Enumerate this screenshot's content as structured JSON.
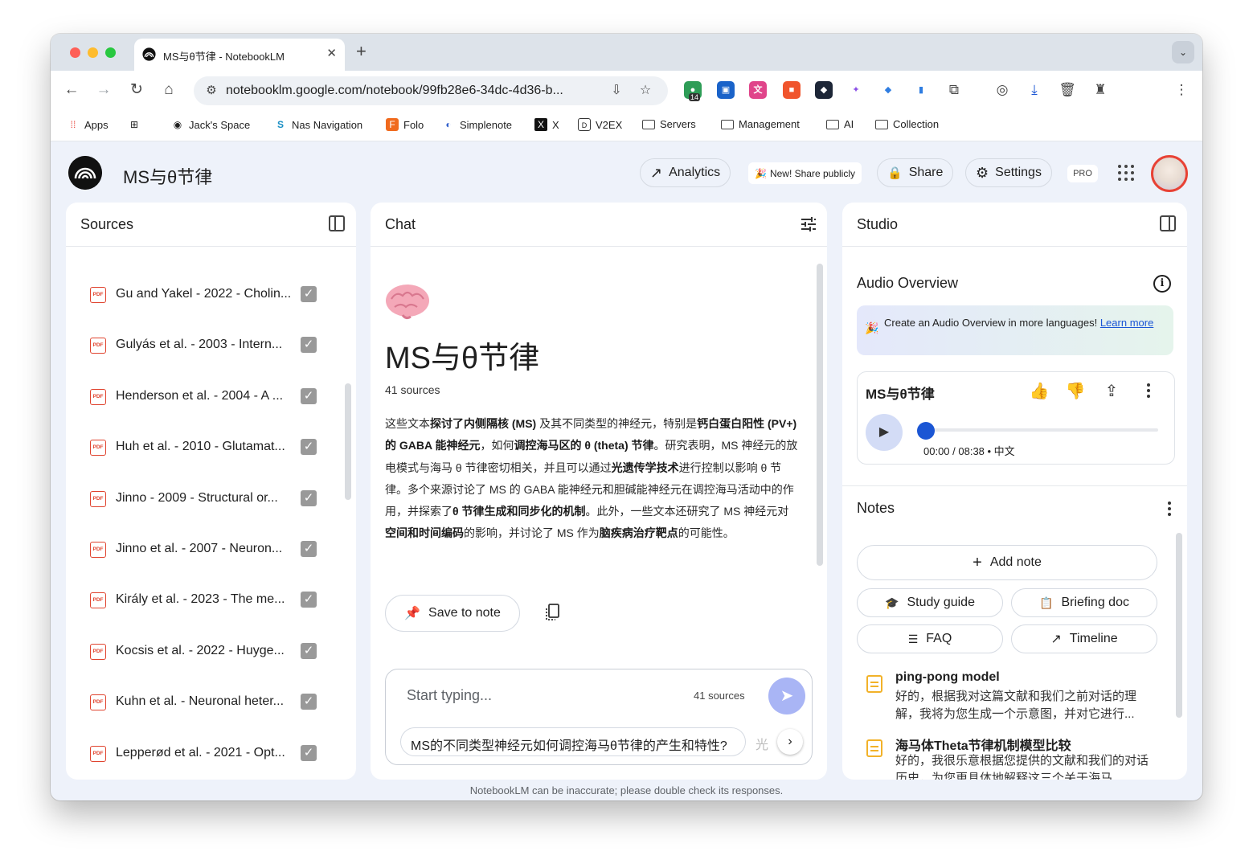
{
  "browser": {
    "tab_title": "MS与θ节律 - NotebookLM",
    "url": "notebooklm.google.com/notebook/99fb28e6-34dc-4d36-b...",
    "extension_badge": "14",
    "bookmarks": [
      {
        "label": "Apps",
        "icon": "apps-grid-icon"
      },
      {
        "label": "Jack's Space",
        "icon": "circle-logo-icon"
      },
      {
        "label": "Nas Navigation",
        "icon": "s-logo-icon"
      },
      {
        "label": "Folo",
        "icon": "folo-icon"
      },
      {
        "label": "Simplenote",
        "icon": "simplenote-icon"
      },
      {
        "label": "X",
        "icon": "x-logo-icon"
      },
      {
        "label": "V2EX",
        "icon": "v2ex-icon"
      },
      {
        "label": "Servers",
        "icon": "folder-icon"
      },
      {
        "label": "Management",
        "icon": "folder-icon"
      },
      {
        "label": "AI",
        "icon": "folder-icon"
      },
      {
        "label": "Collection",
        "icon": "folder-icon"
      }
    ]
  },
  "header": {
    "title": "MS与θ节律",
    "analytics_label": "Analytics",
    "share_public_label": "New! Share publicly",
    "share_label": "Share",
    "settings_label": "Settings",
    "pro_label": "PRO"
  },
  "sources": {
    "title": "Sources",
    "items": [
      {
        "label": "Gu and Yakel - 2022 - Cholin...",
        "checked": true
      },
      {
        "label": "Gulyás et al. - 2003 - Intern...",
        "checked": true
      },
      {
        "label": "Henderson et al. - 2004 - A ...",
        "checked": true
      },
      {
        "label": "Huh et al. - 2010 - Glutamat...",
        "checked": true
      },
      {
        "label": "Jinno - 2009 - Structural or...",
        "checked": true
      },
      {
        "label": "Jinno et al. - 2007 - Neuron...",
        "checked": true
      },
      {
        "label": "Király et al. - 2023 - The me...",
        "checked": true
      },
      {
        "label": "Kocsis et al. - 2022 - Huyge...",
        "checked": true
      },
      {
        "label": "Kuhn et al. - Neuronal heter...",
        "checked": true
      },
      {
        "label": "Lepperød et al. - 2021 - Opt...",
        "checked": true
      }
    ],
    "pdf_label": "PDF"
  },
  "chat": {
    "title": "Chat",
    "notebook_title": "MS与θ节律",
    "source_count": "41 sources",
    "summary": [
      {
        "t": "这些文本",
        "b": false
      },
      {
        "t": "探讨了内侧隔核 (MS)",
        "b": true
      },
      {
        "t": " 及其不同类型的神经元，特别是",
        "b": false
      },
      {
        "t": "钙白蛋白阳性 (PV+) 的 GABA 能神经元",
        "b": true
      },
      {
        "t": "，如何",
        "b": false
      },
      {
        "t": "调控海马区的 θ (theta) 节律",
        "b": true
      },
      {
        "t": "。研究表明，MS 神经元的放电模式与海马 θ 节律密切相关，并且可以通过",
        "b": false
      },
      {
        "t": "光遗传学技术",
        "b": true
      },
      {
        "t": "进行控制以影响 θ 节律。多个来源讨论了 MS 的 GABA 能神经元和胆碱能神经元在调控海马活动中的作用，并探索了",
        "b": false
      },
      {
        "t": "θ 节律生成和同步化的机制",
        "b": true
      },
      {
        "t": "。此外，一些文本还研究了 MS 神经元对",
        "b": false
      },
      {
        "t": "空间和时间编码",
        "b": true
      },
      {
        "t": "的影响，并讨论了 MS 作为",
        "b": false
      },
      {
        "t": "脑疾病治疗靶点",
        "b": true
      },
      {
        "t": "的可能性。",
        "b": false
      }
    ],
    "save_to_note_label": "Save to note",
    "input_placeholder": "Start typing...",
    "input_source_count": "41 sources",
    "suggestion": "MS的不同类型神经元如何调控海马θ节律的产生和特性?",
    "suggestion_next": "光",
    "disclaimer": "NotebookLM can be inaccurate; please double check its responses."
  },
  "studio": {
    "title": "Studio",
    "audio_overview_title": "Audio Overview",
    "promo_text": "Create an Audio Overview in more languages! ",
    "promo_link": "Learn more",
    "audio_title": "MS与θ节律",
    "audio_time": "00:00 / 08:38 • 中文",
    "audio_progress": 0,
    "notes_title": "Notes",
    "add_note_label": "Add note",
    "study_guide_label": "Study guide",
    "briefing_doc_label": "Briefing doc",
    "faq_label": "FAQ",
    "timeline_label": "Timeline",
    "notes": [
      {
        "title": "ping-pong model",
        "body": "好的，根据我对这篇文献和我们之前对话的理解，我将为您生成一个示意图，并对它进行..."
      },
      {
        "title": "海马体Theta节律机制模型比较",
        "body": "好的，我很乐意根据您提供的文献和我们的对话历史，为您更具体地解释这三个关于海马"
      }
    ]
  },
  "colors": {
    "accent": "#1b56d4",
    "pdf": "#e0442f",
    "note": "#f2b229",
    "send": "#a9b5f5"
  }
}
